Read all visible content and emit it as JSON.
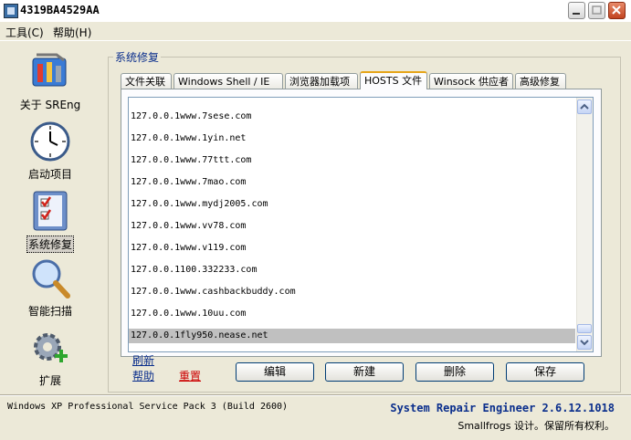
{
  "window": {
    "title": "4319BA4529AA"
  },
  "menu": {
    "tools": "工具(C)",
    "help": "帮助(H)"
  },
  "sidebar": {
    "items": [
      {
        "label": "关于 SREng"
      },
      {
        "label": "启动项目"
      },
      {
        "label": "系统修复"
      },
      {
        "label": "智能扫描"
      },
      {
        "label": "扩展"
      }
    ]
  },
  "group": {
    "title": "系统修复"
  },
  "tabs": [
    "文件关联",
    "Windows Shell / IE",
    "浏览器加载项",
    "HOSTS 文件",
    "Winsock 供应者",
    "高级修复"
  ],
  "hosts": {
    "entries": [
      "127.0.0.1www.7sese.com",
      "127.0.0.1www.1yin.net",
      "127.0.0.1www.77ttt.com",
      "127.0.0.1www.7mao.com",
      "127.0.0.1www.mydj2005.com",
      "127.0.0.1www.vv78.com",
      "127.0.0.1www.v119.com",
      "127.0.0.1100.332233.com",
      "127.0.0.1www.cashbackbuddy.com",
      "127.0.0.1www.10uu.com",
      "127.0.0.1fly950.nease.net"
    ],
    "selected_index": 10
  },
  "links": {
    "refresh": "刷新",
    "help": "帮助",
    "reset": "重置"
  },
  "buttons": {
    "edit": "编辑",
    "new": "新建",
    "delete": "删除",
    "save": "保存"
  },
  "status": {
    "os": "Windows XP Professional Service Pack 3 (Build 2600)",
    "product": "System Repair Engineer 2.6.12.1018",
    "copyright": "Smallfrogs 设计。保留所有权利。"
  },
  "colors": {
    "accent_link": "#0a2e8c",
    "reset_link": "#cc0000",
    "tab_highlight": "#e6a519",
    "selection": "#c0c0c0"
  }
}
